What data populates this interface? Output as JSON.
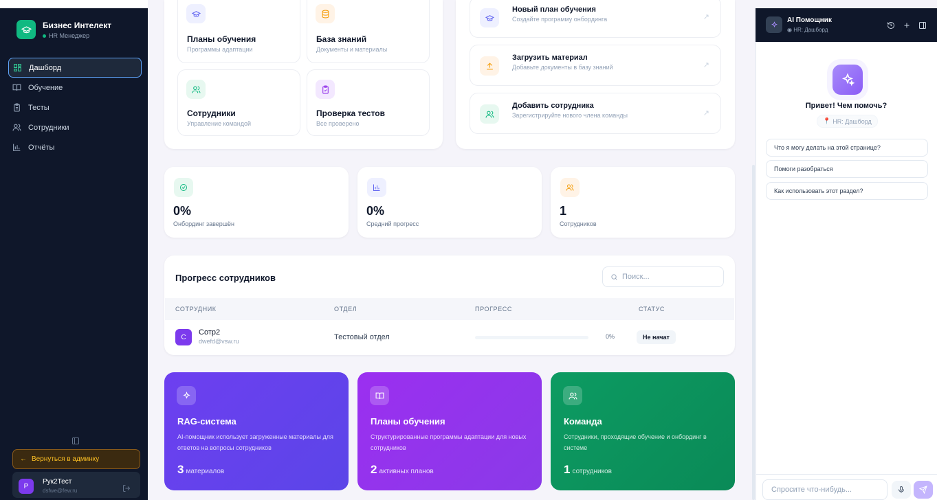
{
  "sidebar": {
    "brand_title": "Бизнес Интелект",
    "brand_role": "HR Менеджер",
    "items": [
      {
        "label": "Дашборд"
      },
      {
        "label": "Обучение"
      },
      {
        "label": "Тесты"
      },
      {
        "label": "Сотрудники"
      },
      {
        "label": "Отчёты"
      }
    ],
    "back_label": "Вернуться в админку",
    "user": {
      "initial": "Р",
      "name": "Рук2Тест",
      "email": "dsfwe@few.ru"
    }
  },
  "quick_cards": [
    {
      "title": "Планы обучения",
      "subtitle": "Программы адаптации"
    },
    {
      "title": "База знаний",
      "subtitle": "Документы и материалы"
    },
    {
      "title": "Сотрудники",
      "subtitle": "Управление командой"
    },
    {
      "title": "Проверка тестов",
      "subtitle": "Все проверено"
    }
  ],
  "actions": [
    {
      "title": "Новый план обучения",
      "subtitle": "Создайте программу онбординга"
    },
    {
      "title": "Загрузить материал",
      "subtitle": "Добавьте документы в базу знаний"
    },
    {
      "title": "Добавить сотрудника",
      "subtitle": "Зарегистрируйте нового члена команды"
    }
  ],
  "stats": [
    {
      "value": "0%",
      "label": "Онбординг завершён"
    },
    {
      "value": "0%",
      "label": "Средний прогресс"
    },
    {
      "value": "1",
      "label": "Сотрудников"
    }
  ],
  "progress": {
    "title": "Прогресс сотрудников",
    "search_placeholder": "Поиск...",
    "columns": [
      "СОТРУДНИК",
      "ОТДЕЛ",
      "ПРОГРЕСС",
      "СТАТУС"
    ],
    "rows": [
      {
        "initial": "С",
        "name": "Сотр2",
        "email": "dwefd@vsw.ru",
        "department": "Тестовый отдел",
        "progress": 0,
        "progress_text": "0%",
        "status": "Не начат"
      }
    ]
  },
  "feature_cards": [
    {
      "title": "RAG-система",
      "description": "AI-помощник использует загруженные материалы для ответов на вопросы сотрудников",
      "count": "3",
      "unit": "материалов",
      "color": "#6d3ff0"
    },
    {
      "title": "Планы обучения",
      "description": "Структурированные программы адаптации для новых сотрудников",
      "count": "2",
      "unit": "активных планов",
      "color": "#9b2ff0"
    },
    {
      "title": "Команда",
      "description": "Сотрудники, проходящие обучение и онбординг в системе",
      "count": "1",
      "unit": "сотрудников",
      "color": "#0d9b62"
    }
  ],
  "assistant": {
    "title": "AI Помощник",
    "context": "HR: Дашборд",
    "greeting": "Привет! Чем помочь?",
    "context_badge": "HR: Дашборд",
    "suggestions": [
      "Что я могу делать на этой странице?",
      "Помоги разобраться",
      "Как использовать этот раздел?"
    ],
    "input_placeholder": "Спросите что-нибудь..."
  }
}
